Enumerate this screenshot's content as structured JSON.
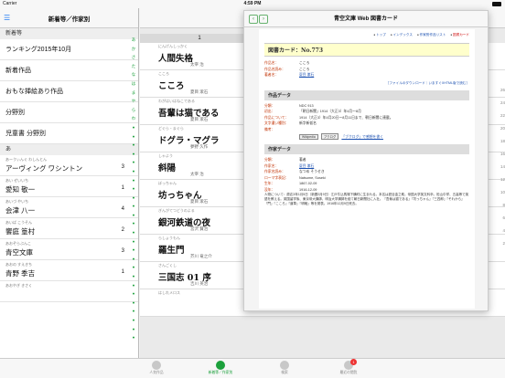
{
  "status": {
    "carrier": "Carrier",
    "time": "4:59 PM"
  },
  "left": {
    "title": "新着等／作家別",
    "section_top": "新着等",
    "menu": [
      "ランキング2015年10月",
      "新着作品",
      "おもな挿絵あり作品",
      "分野別",
      "児童書 分野別"
    ],
    "section_authors": "あ",
    "authors": [
      {
        "kana": "あーゔぃんぐ わしんとん",
        "name": "アーヴィング ワシントン",
        "count": "3"
      },
      {
        "kana": "あい ぜいいち",
        "name": "愛知 敬一",
        "count": "1"
      },
      {
        "kana": "あいづ やいち",
        "name": "会津 八一",
        "count": "4"
      },
      {
        "kana": "あいば こうそん",
        "name": "饗庭 篁村",
        "count": "2"
      },
      {
        "kana": "あおぞらぶんこ",
        "name": "青空文庫",
        "count": "3"
      },
      {
        "kana": "あおの すえきち",
        "name": "青野 季吉",
        "count": "1"
      }
    ],
    "footer_kana": "あおやぎ きさく",
    "index": [
      "あ",
      "か",
      "さ",
      "た",
      "な",
      "は",
      "ま",
      "や",
      "ら",
      "わ",
      "●",
      "●",
      "●",
      "●",
      "●",
      "●",
      "●",
      "●",
      "●",
      "●",
      "●",
      "●",
      "●",
      "●",
      "●",
      "●",
      "●",
      "●",
      "●",
      "●",
      "●",
      "●",
      "●",
      "●",
      "●"
    ]
  },
  "right": {
    "page_number": "1",
    "works": [
      {
        "kana": "にんげんしっかく",
        "title": "人間失格",
        "author": "太宰 治"
      },
      {
        "kana": "こころ",
        "title": "こころ",
        "author": "夏目 漱石"
      },
      {
        "kana": "わがはいはねこである",
        "title": "吾輩は猫である",
        "author": "夏目 漱石"
      },
      {
        "kana": "どぐら・まぐら",
        "title": "ドグラ・マグラ",
        "author": "夢野 久作"
      },
      {
        "kana": "しゃよう",
        "title": "斜陽",
        "author": "太宰 治"
      },
      {
        "kana": "ぼっちゃん",
        "title": "坊っちゃん",
        "author": "夏目 漱石"
      },
      {
        "kana": "ぎんがてつどうのよる",
        "title": "銀河鉄道の夜",
        "author": "宮沢 賢治"
      },
      {
        "kana": "らしょうもん",
        "title": "羅生門",
        "author": "芥川 竜之介"
      },
      {
        "kana": "さんごくし",
        "title": "三国志 01 序",
        "author": "吉川 英治"
      }
    ],
    "last_kana": "はしれメロス",
    "scale": [
      "26",
      "24",
      "22",
      "20",
      "18",
      "16",
      "14",
      "12",
      "10",
      "8",
      "6",
      "4",
      "2"
    ]
  },
  "card": {
    "header": "青空文庫 Web 図書カード",
    "links": [
      "トップ",
      "インデックス",
      "作家別作品リスト",
      "図書カード"
    ],
    "card_title": "図書カード：No.773",
    "work_rows": [
      {
        "k": "作品名：",
        "v": "こころ"
      },
      {
        "k": "作品名読み：",
        "v": "こころ"
      },
      {
        "k": "著者名：",
        "v": "夏目 漱石"
      }
    ],
    "download_links": "［ファイルのダウンロード｜いますぐXHTML版で読む］",
    "section_work": "作品データ",
    "work_data": [
      {
        "k": "分類：",
        "v": "NDC 913"
      },
      {
        "k": "初出：",
        "v": "「朝日新聞」1914（大正3）年4月〜8月"
      },
      {
        "k": "作品について：",
        "v": "1914（大正3）年4月20日〜8月11日まで、朝日新聞に連載。"
      },
      {
        "k": "文字遣い種別：",
        "v": "新字新仮名"
      },
      {
        "k": "備考：",
        "v": ""
      }
    ],
    "wiki_label": "Wikipedia",
    "rating_btn": "ブクログ",
    "review_text": "「ブクログ」で感想を書く",
    "section_author": "作家データ",
    "author_data": [
      {
        "k": "分類：",
        "v": "著者"
      },
      {
        "k": "作家名：",
        "v": "夏目 漱石"
      },
      {
        "k": "作家名読み：",
        "v": "なつめ そうせき"
      },
      {
        "k": "ローマ字表記：",
        "v": "Natsume, Soseki"
      },
      {
        "k": "生年：",
        "v": "1867-02-09"
      },
      {
        "k": "没年：",
        "v": "1916-12-09"
      }
    ],
    "bio": "人物について：慶応3年1月5日（新暦2月9日）江戸牛込馬場下横町に生まれる。本名は夏目金之助。帝国大学英文科卒。松山中学、五高等で英語を教える。英国留学後、東京帝大講師、明治大学講師を経て朝日新聞社に入社。『吾輩は猫である』『坊っちゃん』『三四郎』『それから』『門』『こころ』『道草』『明暗』等を発表。1916年12月9日死去。"
  },
  "tabbar": [
    {
      "label": "人気作品",
      "active": false
    },
    {
      "label": "新着等／作家別",
      "active": true
    },
    {
      "label": "検索",
      "active": false
    },
    {
      "label": "最近の閲覧",
      "active": false,
      "badge": "1"
    }
  ]
}
